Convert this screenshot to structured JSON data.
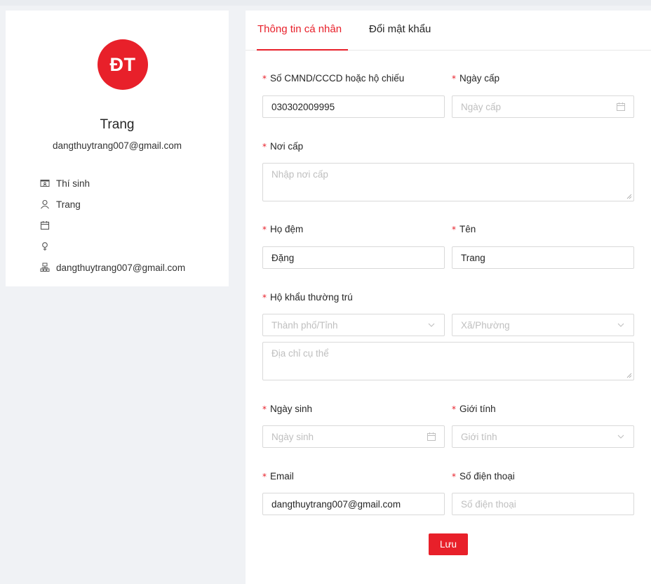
{
  "profile": {
    "avatar_initials": "ĐT",
    "name": "Trang",
    "email": "dangthuytrang007@gmail.com",
    "info": [
      {
        "icon": "id-card-icon",
        "value": "Thí sinh"
      },
      {
        "icon": "user-icon",
        "value": "Trang"
      },
      {
        "icon": "calendar-icon",
        "value": ""
      },
      {
        "icon": "gender-female-icon",
        "value": ""
      },
      {
        "icon": "organization-icon",
        "value": "dangthuytrang007@gmail.com"
      }
    ]
  },
  "tabs": [
    {
      "label": "Thông tin cá nhân",
      "active": true
    },
    {
      "label": "Đổi mật khẩu",
      "active": false
    }
  ],
  "form": {
    "required_mark": "*",
    "id_number": {
      "label": "Số CMND/CCCD hoặc hộ chiếu",
      "value": "030302009995"
    },
    "issue_date": {
      "label": "Ngày cấp",
      "placeholder": "Ngày cấp"
    },
    "issue_place": {
      "label": "Nơi cấp",
      "placeholder": "Nhập nơi cấp"
    },
    "middle_name": {
      "label": "Họ đệm",
      "value": "Đặng"
    },
    "first_name": {
      "label": "Tên",
      "value": "Trang"
    },
    "residence": {
      "label": "Hộ khẩu thường trú",
      "city_placeholder": "Thành phố/Tỉnh",
      "ward_placeholder": "Xã/Phường",
      "address_placeholder": "Địa chỉ cụ thể"
    },
    "birth_date": {
      "label": "Ngày sinh",
      "placeholder": "Ngày sinh"
    },
    "gender": {
      "label": "Giới tính",
      "placeholder": "Giới tính"
    },
    "email": {
      "label": "Email",
      "value": "dangthuytrang007@gmail.com"
    },
    "phone": {
      "label": "Số điện thoại",
      "placeholder": "Số điện thoại"
    },
    "save_label": "Lưu"
  },
  "colors": {
    "accent": "#e8202a",
    "border": "#d9d9d9",
    "placeholder": "#bfbfbf"
  }
}
